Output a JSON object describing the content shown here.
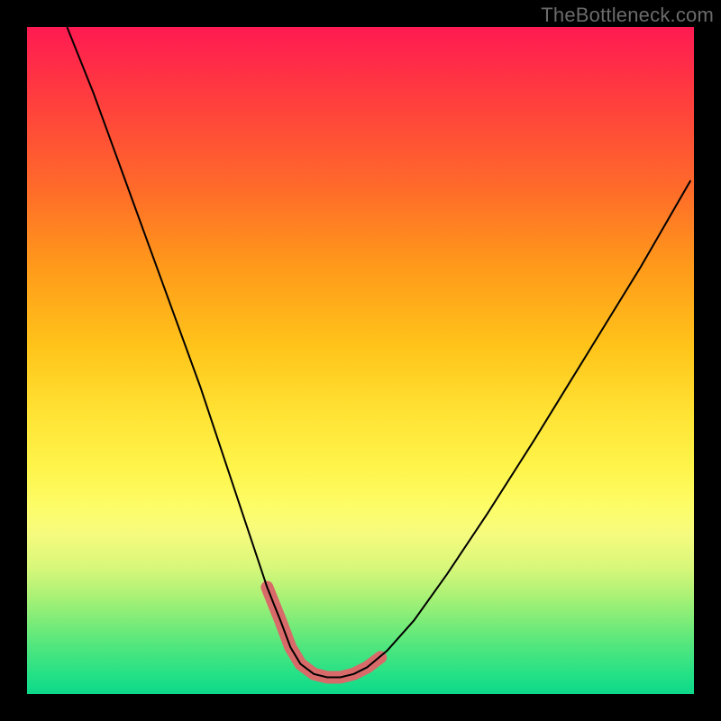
{
  "watermark": "TheBottleneck.com",
  "chart_data": {
    "type": "line",
    "title": "",
    "xlabel": "",
    "ylabel": "",
    "xlim": [
      0,
      100
    ],
    "ylim": [
      0,
      100
    ],
    "grid": false,
    "legend": false,
    "series": [
      {
        "name": "curve",
        "color": "#000000",
        "stroke_width": 2,
        "x": [
          6,
          10,
          14,
          18,
          22,
          26,
          29,
          32,
          34,
          36,
          38,
          39.5,
          41,
          43,
          45,
          47,
          49,
          51,
          54,
          58,
          63,
          69,
          76,
          84,
          92,
          99.5
        ],
        "y": [
          100,
          90,
          79,
          68,
          57,
          46,
          37,
          28,
          22,
          16,
          11,
          7,
          4.5,
          3,
          2.5,
          2.5,
          3.0,
          4.0,
          6.5,
          11,
          18,
          27,
          38,
          51,
          64,
          77
        ]
      },
      {
        "name": "highlight",
        "color": "#d96a6a",
        "stroke_width": 14,
        "x": [
          36,
          38,
          39.5,
          41,
          43,
          45,
          47,
          49,
          51,
          53
        ],
        "y": [
          16,
          11,
          7,
          4.5,
          3,
          2.5,
          2.5,
          3.0,
          4.0,
          5.5
        ]
      }
    ]
  }
}
